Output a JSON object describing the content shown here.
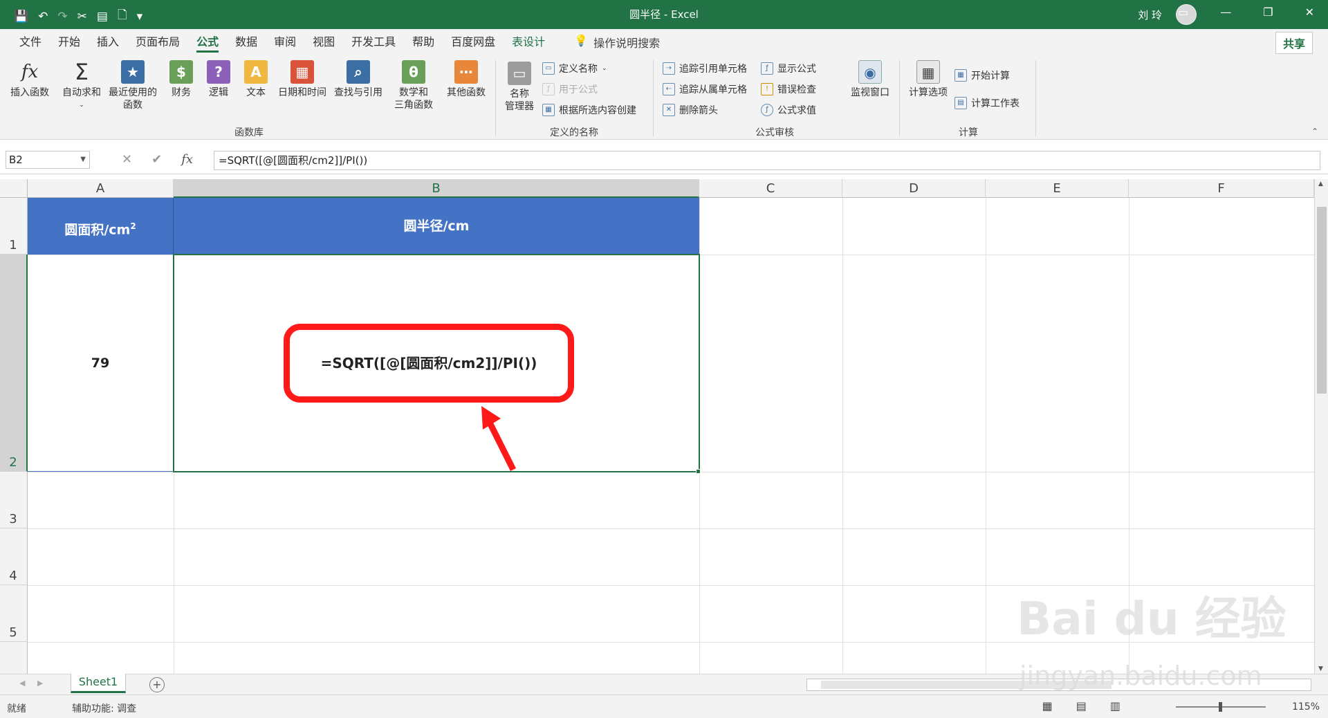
{
  "window": {
    "title": "圆半径 - Excel",
    "user": "刘 玲",
    "qat": [
      "💾",
      "↶",
      "↷",
      "✂",
      "▤",
      "🗋",
      "▾"
    ],
    "controls": [
      "▭",
      "—",
      "❐",
      "✕"
    ]
  },
  "tabs": [
    "文件",
    "开始",
    "插入",
    "页面布局",
    "公式",
    "数据",
    "审阅",
    "视图",
    "开发工具",
    "帮助",
    "百度网盘",
    "表设计"
  ],
  "active_tab": "公式",
  "tell_me": "操作说明搜索",
  "share": "共享",
  "ribbon": {
    "insert_function": "插入函数",
    "autosum": "自动求和",
    "recent_1": "最近使用的",
    "recent_2": "函数",
    "financial": "财务",
    "logical": "逻辑",
    "text": "文本",
    "datetime": "日期和时间",
    "lookup": "查找与引用",
    "math_1": "数学和",
    "math_2": "三角函数",
    "more": "其他函数",
    "group_library": "函数库",
    "name_manager_1": "名称",
    "name_manager_2": "管理器",
    "define_name": "定义名称",
    "use_in_formula": "用于公式",
    "create_from_selection": "根据所选内容创建",
    "group_names": "定义的名称",
    "trace_precedents": "追踪引用单元格",
    "trace_dependents": "追踪从属单元格",
    "remove_arrows": "删除箭头",
    "show_formulas": "显示公式",
    "error_checking": "错误检查",
    "evaluate_formula": "公式求值",
    "watch_window": "监视窗口",
    "group_auditing": "公式审核",
    "calc_options": "计算选项",
    "calc_now": "开始计算",
    "calc_sheet": "计算工作表",
    "group_calc": "计算"
  },
  "formula_bar": {
    "name_box": "B2",
    "formula": "=SQRT([@[圆面积/cm2]]/PI())",
    "cancel": "✕",
    "enter": "✔",
    "fx": "fx"
  },
  "columns": [
    "A",
    "B",
    "C",
    "D",
    "E",
    "F"
  ],
  "rows": [
    "1",
    "2",
    "3",
    "4",
    "5"
  ],
  "cells": {
    "A1": "圆面积/cm",
    "A1_sup": "2",
    "B1": "圆半径/cm",
    "A2": "79"
  },
  "annotation": "=SQRT([@[圆面积/cm2]]/PI())",
  "sheet": {
    "tab": "Sheet1",
    "add": "+"
  },
  "status": {
    "ready": "就绪",
    "accessibility": "辅助功能: 调查",
    "zoom": "115%"
  },
  "watermark": {
    "brand": "Bai du 经验",
    "url": "jingyan.baidu.com"
  },
  "colors": {
    "excel_green": "#217346",
    "header_fill": "#4472c4",
    "annotation_red": "#ff1a1a"
  }
}
